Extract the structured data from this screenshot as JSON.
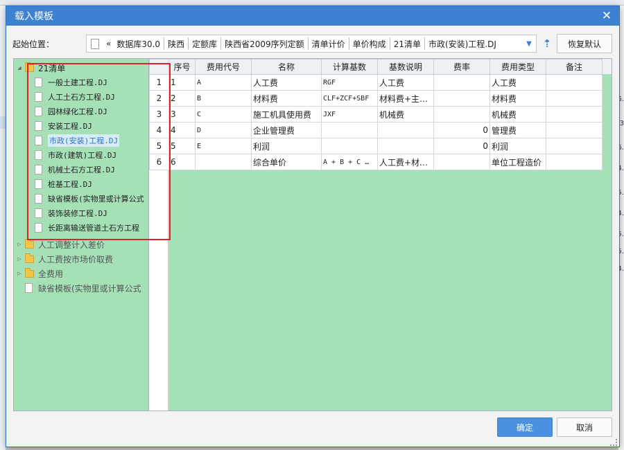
{
  "dialog": {
    "title": "载入模板",
    "close_glyph": "✕"
  },
  "toolbar": {
    "start_label": "起始位置：",
    "path_prefix": "«",
    "path": [
      "数据库30.0",
      "陕西",
      "定额库",
      "陕西省2009序列定额",
      "清单计价",
      "单价构成",
      "21清单",
      "市政(安装)工程.DJ"
    ],
    "restore_label": "恢复默认"
  },
  "tree": {
    "root": {
      "label": "21清单",
      "icon": "folder-icon",
      "expanded": true
    },
    "files": [
      "一般土建工程.DJ",
      "人工土石方工程.DJ",
      "园林绿化工程.DJ",
      "安装工程.DJ",
      "市政(安装)工程.DJ",
      "市政(建筑)工程.DJ",
      "机械土石方工程.DJ",
      "桩基工程.DJ",
      "缺省模板(实物里或计算公式",
      "装饰装修工程.DJ",
      "长距离输送管道土石方工程"
    ],
    "selected_index": 4,
    "other_folders": [
      "人工调整计入差价",
      "人工费按市场价取费",
      "全费用"
    ],
    "bottom_file": "缺省模板(实物里或计算公式"
  },
  "grid": {
    "headers": [
      "序号",
      "费用代号",
      "名称",
      "计算基数",
      "基数说明",
      "费率",
      "费用类型",
      "备注"
    ],
    "rows": [
      {
        "rownum": "1",
        "seq": "1",
        "code": "A",
        "name": "人工费",
        "base": "RGF",
        "desc": "人工费",
        "rate": "",
        "type": "人工费",
        "note": ""
      },
      {
        "rownum": "2",
        "seq": "2",
        "code": "B",
        "name": "材料费",
        "base": "CLF+ZCF+SBF",
        "desc": "材料费+主…",
        "rate": "",
        "type": "材料费",
        "note": ""
      },
      {
        "rownum": "3",
        "seq": "3",
        "code": "C",
        "name": "施工机具使用费",
        "base": "JXF",
        "desc": "机械费",
        "rate": "",
        "type": "机械费",
        "note": ""
      },
      {
        "rownum": "4",
        "seq": "4",
        "code": "D",
        "name": "企业管理费",
        "base": "",
        "desc": "",
        "rate": "0",
        "type": "管理费",
        "note": ""
      },
      {
        "rownum": "5",
        "seq": "5",
        "code": "E",
        "name": "利润",
        "base": "",
        "desc": "",
        "rate": "0",
        "type": "利润",
        "note": ""
      },
      {
        "rownum": "6",
        "seq": "6",
        "code": "",
        "name": "综合单价",
        "base": "A + B + C …",
        "desc": "人工费+材…",
        "rate": "",
        "type": "单位工程造价",
        "note": ""
      }
    ]
  },
  "footer": {
    "ok_label": "确定",
    "cancel_label": "取消"
  },
  "bg_numbers": [
    "6.",
    "23",
    "6.",
    "4.",
    "5.",
    "4.",
    "5.",
    "5.",
    "4."
  ],
  "colors": {
    "title_bar": "#3c82d1",
    "panel_green": "#a6e0b7",
    "highlight_red": "#e0202a",
    "ok_blue": "#4a92e0"
  }
}
